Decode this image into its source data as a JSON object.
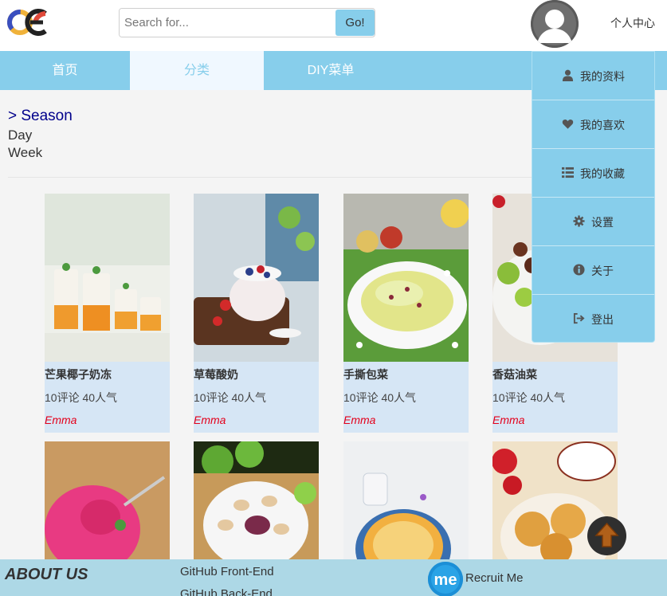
{
  "search": {
    "placeholder": "Search for...",
    "value": "",
    "button_label": "Go!"
  },
  "header": {
    "user_center": "个人中心"
  },
  "nav": {
    "tabs": [
      {
        "label": "首页"
      },
      {
        "label": "分类"
      },
      {
        "label": "DIY菜单"
      }
    ],
    "active_tab": "分类"
  },
  "season": {
    "title": "> Season",
    "items": [
      "Day",
      "Week"
    ]
  },
  "cards": [
    {
      "title": "芒果椰子奶冻",
      "stats": "10评论 40人气",
      "author": "Emma"
    },
    {
      "title": "草莓酸奶",
      "stats": "10评论 40人气",
      "author": "Emma"
    },
    {
      "title": "手撕包菜",
      "stats": "10评论 40人气",
      "author": "Emma"
    },
    {
      "title": "香菇油菜",
      "stats": "10评论 40人气",
      "author": "Emma"
    }
  ],
  "dropdown": {
    "items": [
      {
        "label": "我的资料",
        "icon": "user-icon"
      },
      {
        "label": "我的喜欢",
        "icon": "heart-icon"
      },
      {
        "label": "我的收藏",
        "icon": "list-icon"
      },
      {
        "label": "设置",
        "icon": "gear-icon"
      },
      {
        "label": "关于",
        "icon": "info-icon"
      },
      {
        "label": "登出",
        "icon": "logout-icon"
      }
    ]
  },
  "footer": {
    "about": "ABOUT US",
    "links": [
      "GitHub Front-End",
      "GitHub Back-End"
    ],
    "recruit": "Recruit Me",
    "logo_text": "me"
  },
  "colors": {
    "accent": "#87ceeb",
    "card_bg": "#d6e6f5",
    "author": "#e4001b",
    "season_title": "#00008b",
    "footer_bg": "#add8e6"
  }
}
